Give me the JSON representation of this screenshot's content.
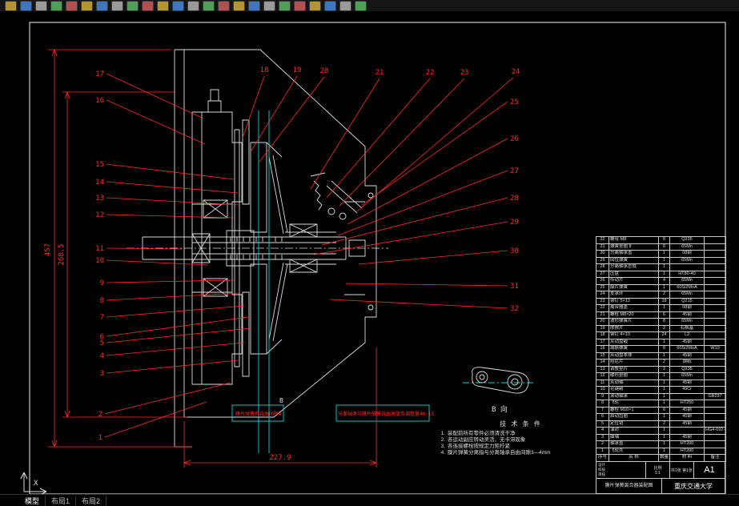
{
  "toolbar": {
    "icons": [
      "new-file",
      "open-file",
      "save",
      "plot",
      "print-preview",
      "publish",
      "cut",
      "copy",
      "paste",
      "match-properties",
      "undo",
      "redo",
      "pan",
      "zoom-window",
      "zoom-previous",
      "layer",
      "layer-properties",
      "color-control",
      "linetype-control",
      "lineweight-control",
      "text-style",
      "dimension-style",
      "table-style",
      "help"
    ]
  },
  "drawing": {
    "callouts": [
      "1",
      "2",
      "3",
      "4",
      "5",
      "6",
      "7",
      "8",
      "9",
      "10",
      "11",
      "12",
      "13",
      "14",
      "15",
      "16",
      "17",
      "18",
      "19",
      "20",
      "21",
      "22",
      "23",
      "24",
      "25",
      "26",
      "27",
      "28",
      "29",
      "30",
      "31",
      "32"
    ],
    "dimensions": {
      "total_height": "457",
      "inner_height": "268.5",
      "bottom_width": "227.9"
    },
    "annotations": {
      "left_note": "膜片弹簧有自由间隙4",
      "right_note": "分离轴承与膜片弹簧自由高度及调整量40-15",
      "view_arrow": "B",
      "detail_label": "B 向"
    },
    "tech_notes": {
      "title": "技 术 条 件",
      "items": [
        "装配前所有零件必须清洗干净",
        "各运动副应转动灵活、无卡滞现象",
        "各连接螺栓按规定力矩拧紧",
        "膜片弹簧分离指与分离轴承自由间隙3—4mm"
      ]
    }
  },
  "bom": {
    "headers": [
      "序号",
      "名  称",
      "数量",
      "材  料",
      "备注"
    ],
    "rows": [
      [
        "32",
        "螺母 M8",
        "6",
        "Q235",
        ""
      ],
      [
        "31",
        "弹簧垫圈 8",
        "6",
        "65Mn",
        ""
      ],
      [
        "30",
        "分离轴承盖",
        "1",
        "08钢",
        ""
      ],
      [
        "29",
        "回位弹簧",
        "1",
        "65Mn",
        ""
      ],
      [
        "28",
        "分离轴承总成",
        "1",
        "",
        ""
      ],
      [
        "27",
        "压盘",
        "1",
        "HT80-40",
        ""
      ],
      [
        "26",
        "传动片",
        "4",
        "65Mn",
        ""
      ],
      [
        "25",
        "膜片弹簧",
        "1",
        "60Si2MnA",
        ""
      ],
      [
        "24",
        "支承环",
        "2",
        "65Mn",
        ""
      ],
      [
        "23",
        "铆钉 5×12",
        "18",
        "Q215",
        ""
      ],
      [
        "22",
        "离合器盖",
        "1",
        "08钢",
        ""
      ],
      [
        "21",
        "螺栓 M8×20",
        "6",
        "45钢",
        ""
      ],
      [
        "20",
        "波形弹簧片",
        "8",
        "65Mn",
        ""
      ],
      [
        "19",
        "摩擦片",
        "2",
        "石棉基",
        ""
      ],
      [
        "18",
        "铆钉 4×10",
        "24",
        "L2",
        ""
      ],
      [
        "17",
        "从动盘毂",
        "1",
        "45钢",
        ""
      ],
      [
        "16",
        "减振弹簧",
        "6",
        "60Si2MnA",
        "W10"
      ],
      [
        "15",
        "从动盘本体",
        "1",
        "45钢",
        ""
      ],
      [
        "14",
        "阻尼片",
        "2",
        "钢纸",
        ""
      ],
      [
        "13",
        "调整垫片",
        "2",
        "Q235",
        ""
      ],
      [
        "12",
        "碟形垫圈",
        "1",
        "65Mn",
        ""
      ],
      [
        "11",
        "从动轴",
        "1",
        "45钢",
        ""
      ],
      [
        "10",
        "花键毂",
        "1",
        "40Cr",
        ""
      ],
      [
        "9",
        "滚动轴承",
        "1",
        "",
        "GB297"
      ],
      [
        "8",
        "飞轮",
        "1",
        "HT250",
        ""
      ],
      [
        "7",
        "螺栓 M10×1",
        "6",
        "45钢",
        ""
      ],
      [
        "6",
        "启动齿圈",
        "1",
        "45钢",
        ""
      ],
      [
        "5",
        "定位销",
        "2",
        "45钢",
        ""
      ],
      [
        "4",
        "油封",
        "1",
        "",
        "HG4-692-67"
      ],
      [
        "3",
        "曲轴",
        "1",
        "45钢",
        ""
      ],
      [
        "2",
        "轴承盖",
        "1",
        "HT200",
        ""
      ],
      [
        "1",
        "飞轮壳",
        "1",
        "HT200",
        ""
      ]
    ]
  },
  "title_block": {
    "design_label": "设计",
    "check_label": "校核",
    "audit_label": "审核",
    "scale_label": "比例",
    "scale_value": "1:1",
    "sheet_label": "共1张 第1张",
    "paper_size": "A1",
    "drawing_title": "膜片弹簧离合器装配图",
    "school": "重庆交通大学"
  },
  "status_bar": {
    "tabs": [
      "模型",
      "布局1",
      "布局2"
    ]
  },
  "ucs": {
    "x_label": "X"
  },
  "colors": {
    "line": "#dcdcdc",
    "accent_red": "#ff2a2a",
    "centerline_cyan": "#00d8d8",
    "background": "#000000"
  }
}
